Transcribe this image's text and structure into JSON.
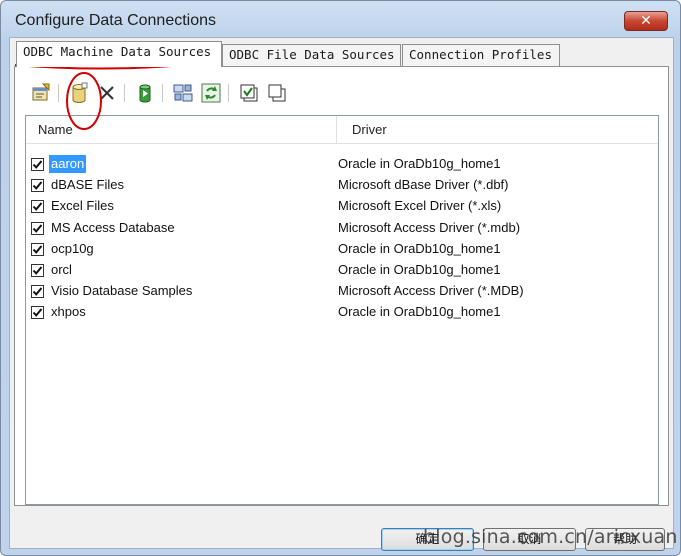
{
  "window": {
    "title": "Configure Data Connections",
    "close_label": "✕"
  },
  "tabs": [
    {
      "label": "ODBC Machine Data Sources",
      "active": true
    },
    {
      "label": "ODBC File Data Sources",
      "active": false
    },
    {
      "label": "Connection Profiles",
      "active": false
    }
  ],
  "toolbar": {
    "buttons": [
      "properties-icon",
      "add-data-source-icon",
      "delete-icon",
      "connect-icon",
      "configure-icon",
      "refresh-icon",
      "select-all-icon",
      "copy-icon"
    ]
  },
  "list": {
    "columns": {
      "name": "Name",
      "driver": "Driver"
    },
    "rows": [
      {
        "name": "aaron",
        "driver": "Oracle in OraDb10g_home1",
        "checked": true,
        "selected": true
      },
      {
        "name": "dBASE Files",
        "driver": "Microsoft dBase Driver (*.dbf)",
        "checked": true
      },
      {
        "name": "Excel Files",
        "driver": "Microsoft Excel Driver (*.xls)",
        "checked": true
      },
      {
        "name": "MS Access Database",
        "driver": "Microsoft Access Driver (*.mdb)",
        "checked": true
      },
      {
        "name": "ocp10g",
        "driver": "Oracle in OraDb10g_home1",
        "checked": true
      },
      {
        "name": "orcl",
        "driver": "Oracle in OraDb10g_home1",
        "checked": true
      },
      {
        "name": "Visio Database Samples",
        "driver": "Microsoft Access Driver (*.MDB)",
        "checked": true
      },
      {
        "name": "xhpos",
        "driver": "Oracle in OraDb10g_home1",
        "checked": true
      }
    ]
  },
  "buttons": {
    "ok": "确定",
    "cancel": "取消",
    "help": "帮助"
  },
  "watermark": "blog.sina.com.cn/aricxuan",
  "colors": {
    "selection": "#3399ff",
    "annotation": "#d40000",
    "close": "#c74632"
  }
}
